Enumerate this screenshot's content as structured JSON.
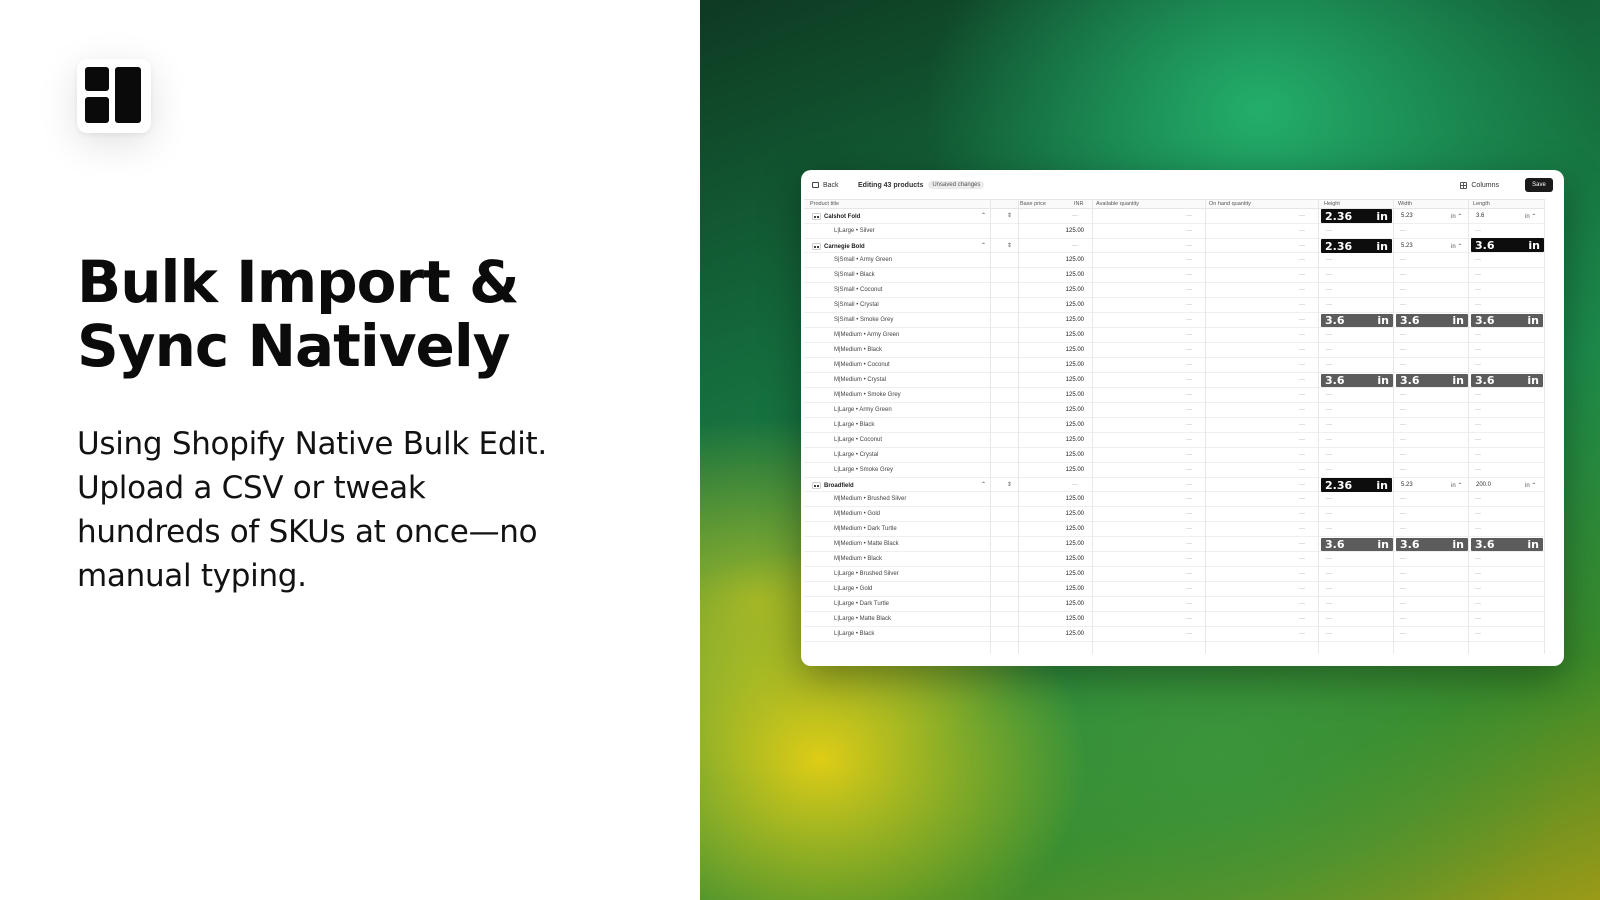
{
  "hero": {
    "headline": "Bulk Import & Sync Natively",
    "subtext": "Using Shopify Native Bulk Edit. Upload a CSV or tweak hundreds of SKUs at once—no manual typing."
  },
  "editor": {
    "back_label": "Back",
    "title": "Editing 43 products",
    "status_badge": "Unsaved changes",
    "columns_label": "Columns",
    "save_label": "Save",
    "columns": {
      "product_title": "Product title",
      "base_price": "Base price",
      "currency": "INR",
      "available_quantity": "Available quantity",
      "on_hand_quantity": "On hand quantity",
      "height": "Height",
      "width": "Width",
      "length": "Length"
    },
    "dash": "—",
    "unit_small": "in ⌃",
    "chip_unit": "in",
    "rows": [
      {
        "type": "parent",
        "title": "Calshot Fold",
        "height": "2.36",
        "width": "5.23",
        "length": "3.6"
      },
      {
        "type": "variant",
        "label": "L|Large • Silver",
        "price": "125.00"
      },
      {
        "type": "parent",
        "title": "Carnegie Bold",
        "height": "2.36",
        "width": "5.23",
        "length": "3.6"
      },
      {
        "type": "variant",
        "label": "S|Small • Army Green",
        "price": "125.00"
      },
      {
        "type": "variant",
        "label": "S|Small • Black",
        "price": "125.00"
      },
      {
        "type": "variant",
        "label": "S|Small • Coconut",
        "price": "125.00"
      },
      {
        "type": "variant",
        "label": "S|Small • Crystal",
        "price": "125.00"
      },
      {
        "type": "variant",
        "label": "S|Small • Smoke Grey",
        "price": "125.00",
        "height": "3.6",
        "width": "3.6",
        "length": "3.6"
      },
      {
        "type": "variant",
        "label": "M|Medium • Army Green",
        "price": "125.00"
      },
      {
        "type": "variant",
        "label": "M|Medium • Black",
        "price": "125.00"
      },
      {
        "type": "variant",
        "label": "M|Medium • Coconut",
        "price": "125.00"
      },
      {
        "type": "variant",
        "label": "M|Medium • Crystal",
        "price": "125.00",
        "height": "3.6",
        "width": "3.6",
        "length": "3.6"
      },
      {
        "type": "variant",
        "label": "M|Medium • Smoke Grey",
        "price": "125.00"
      },
      {
        "type": "variant",
        "label": "L|Large • Army Green",
        "price": "125.00"
      },
      {
        "type": "variant",
        "label": "L|Large • Black",
        "price": "125.00"
      },
      {
        "type": "variant",
        "label": "L|Large • Coconut",
        "price": "125.00"
      },
      {
        "type": "variant",
        "label": "L|Large • Crystal",
        "price": "125.00"
      },
      {
        "type": "variant",
        "label": "L|Large • Smoke Grey",
        "price": "125.00"
      },
      {
        "type": "parent",
        "title": "Broadfield",
        "height": "2.36",
        "width": "5.23",
        "length": "200.0"
      },
      {
        "type": "variant",
        "label": "M|Medium • Brushed Silver",
        "price": "125.00"
      },
      {
        "type": "variant",
        "label": "M|Medium • Gold",
        "price": "125.00"
      },
      {
        "type": "variant",
        "label": "M|Medium • Dark Turtle",
        "price": "125.00"
      },
      {
        "type": "variant",
        "label": "M|Medium • Matte Black",
        "price": "125.00",
        "height": "3.6",
        "width": "3.6",
        "length": "3.6"
      },
      {
        "type": "variant",
        "label": "M|Medium • Black",
        "price": "125.00"
      },
      {
        "type": "variant",
        "label": "L|Large • Brushed Silver",
        "price": "125.00"
      },
      {
        "type": "variant",
        "label": "L|Large • Gold",
        "price": "125.00"
      },
      {
        "type": "variant",
        "label": "L|Large • Dark Turtle",
        "price": "125.00"
      },
      {
        "type": "variant",
        "label": "L|Large • Matte Black",
        "price": "125.00"
      },
      {
        "type": "variant",
        "label": "L|Large • Black",
        "price": "125.00"
      }
    ]
  },
  "icons": {
    "logo": "layout-blocks-icon",
    "back": "sidebar-back-icon",
    "columns": "columns-icon",
    "expand": "chevron-up-icon",
    "sort": "sort-stepper-icon"
  },
  "colors": {
    "chip_dark": "#0d0d0d",
    "chip_grey": "#5c5c5c",
    "bg_green": "#1c8a4a",
    "bg_yellow": "#e8d014"
  }
}
